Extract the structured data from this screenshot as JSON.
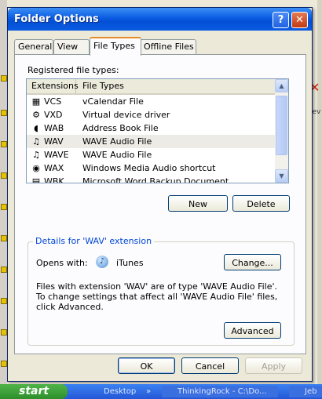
{
  "window": {
    "title": "Folder Options",
    "help_icon": "?",
    "close_icon": "✕"
  },
  "tabs": [
    "General",
    "View",
    "File Types",
    "Offline Files"
  ],
  "registered_label": "Registered file types:",
  "columns": {
    "extensions": "Extensions",
    "file_types": "File Types"
  },
  "file_types": [
    {
      "ext": "VCS",
      "type": "vCalendar File",
      "icon": "calendar-icon",
      "glyph": "▦"
    },
    {
      "ext": "VXD",
      "type": "Virtual device driver",
      "icon": "gear-icon",
      "glyph": "⚙"
    },
    {
      "ext": "WAB",
      "type": "Address Book File",
      "icon": "address-book-icon",
      "glyph": "◖"
    },
    {
      "ext": "WAV",
      "type": "WAVE Audio File",
      "icon": "music-note-icon",
      "glyph": "♫",
      "selected": true
    },
    {
      "ext": "WAVE",
      "type": "WAVE Audio File",
      "icon": "music-note-icon",
      "glyph": "♫"
    },
    {
      "ext": "WAX",
      "type": "Windows Media Audio shortcut",
      "icon": "media-player-icon",
      "glyph": "◉"
    },
    {
      "ext": "WBK",
      "type": "Microsoft Word Backup Document",
      "icon": "document-icon",
      "glyph": "▤"
    }
  ],
  "buttons": {
    "new": "New",
    "delete": "Delete",
    "change": "Change...",
    "advanced": "Advanced",
    "ok": "OK",
    "cancel": "Cancel",
    "apply": "Apply"
  },
  "details": {
    "legend": "Details for 'WAV' extension",
    "opens_with_label": "Opens with:",
    "app_name": "iTunes",
    "description": "Files with extension 'WAV' are of type 'WAVE Audio File'.  To change settings that affect all 'WAVE Audio File' files, click Advanced."
  },
  "taskbar": {
    "start": "start",
    "items": [
      "Desktop",
      "»",
      "ThinkingRock - C:\\Do...",
      "Jeb"
    ]
  },
  "background": {
    "rev_text": "rev"
  }
}
